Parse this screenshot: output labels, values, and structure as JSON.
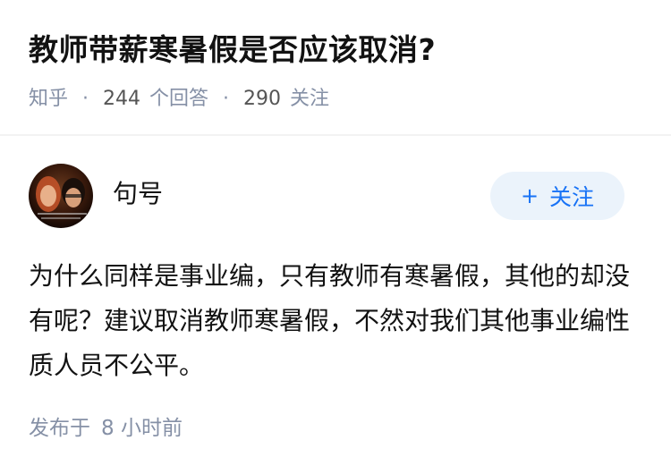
{
  "question": {
    "title": "教师带薪寒暑假是否应该取消?",
    "source": "知乎",
    "answer_count": "244",
    "answer_label": "个回答",
    "follower_count": "290",
    "follower_label": "关注"
  },
  "author": {
    "name": "句号",
    "follow_plus": "+",
    "follow_label": "关注"
  },
  "answer": {
    "content": "为什么同样是事业编，只有教师有寒暑假，其他的却没有呢？建议取消教师寒暑假，不然对我们其他事业编性质人员不公平。",
    "time_label": "发布于",
    "time_value": "8 小时前"
  },
  "colors": {
    "accent": "#1772f6",
    "follow_bg": "#ebf3fb",
    "meta_text": "#8590a6"
  }
}
